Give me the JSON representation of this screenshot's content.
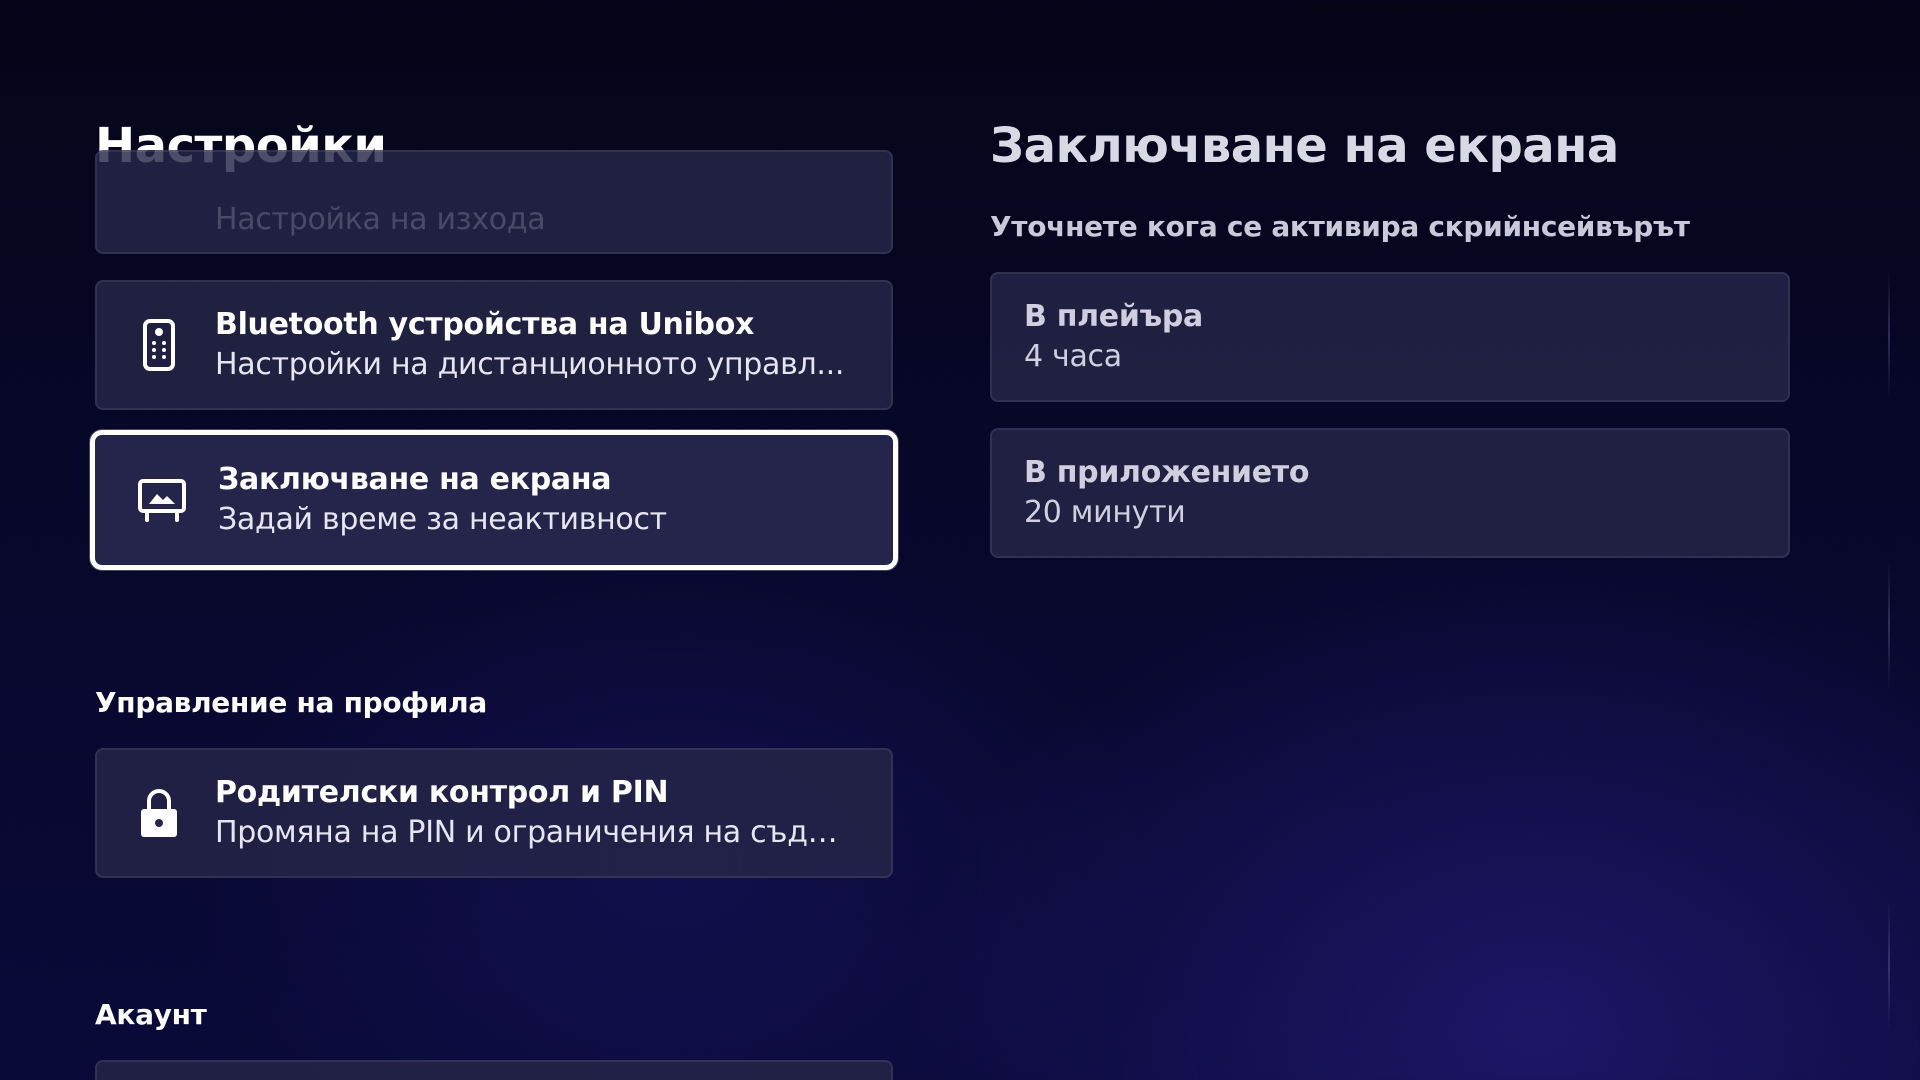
{
  "settings": {
    "title": "Настройки",
    "partial_item": {
      "subtitle": "Настройка на изхода"
    },
    "items": [
      {
        "title": "Bluetooth устройства на Unibox",
        "subtitle": "Настройки на дистанционното управл...",
        "icon": "remote-control-icon"
      },
      {
        "title": "Заключване на екрана",
        "subtitle": "Задай време за неактивност",
        "icon": "screen-lock-icon"
      }
    ],
    "profile_section": {
      "heading": "Управление на профила",
      "items": [
        {
          "title": "Родителски контрол и PIN",
          "subtitle": "Промяна на PIN и ограничения на съдър...",
          "icon": "lock-icon"
        }
      ]
    },
    "account_section": {
      "heading": "Акаунт"
    }
  },
  "detail": {
    "title": "Заключване на екрана",
    "subtitle": "Уточнете кога се активира скрийнсейвърът",
    "options": [
      {
        "title": "В плейъра",
        "value": "4 часа"
      },
      {
        "title": "В приложението",
        "value": "20 минути"
      }
    ]
  },
  "colors": {
    "background": "#07072a",
    "card": "#262648",
    "focus_border": "#ffffff",
    "text": "#ffffff",
    "muted_text": "#cfcfdf"
  }
}
